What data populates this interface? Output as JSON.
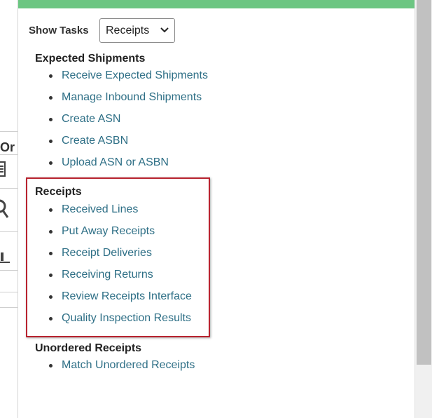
{
  "background": {
    "partial_heading": "Or"
  },
  "panel": {
    "accent_color": "#6cc682",
    "show_tasks_label": "Show Tasks",
    "select": {
      "selected": "Receipts"
    },
    "sections": [
      {
        "title": "Expected Shipments",
        "items": [
          "Receive Expected Shipments",
          "Manage Inbound Shipments",
          "Create ASN",
          "Create ASBN",
          "Upload ASN or ASBN"
        ]
      },
      {
        "title": "Receipts",
        "highlight_color": "#b8232f",
        "items": [
          "Received Lines",
          "Put Away Receipts",
          "Receipt Deliveries",
          "Receiving Returns",
          "Review Receipts Interface",
          "Quality Inspection Results"
        ]
      },
      {
        "title": "Unordered Receipts",
        "items": [
          "Match Unordered Receipts"
        ]
      }
    ]
  },
  "icons": [
    "document-icon",
    "search-icon",
    "chart-icon",
    "chevron-down-icon"
  ]
}
